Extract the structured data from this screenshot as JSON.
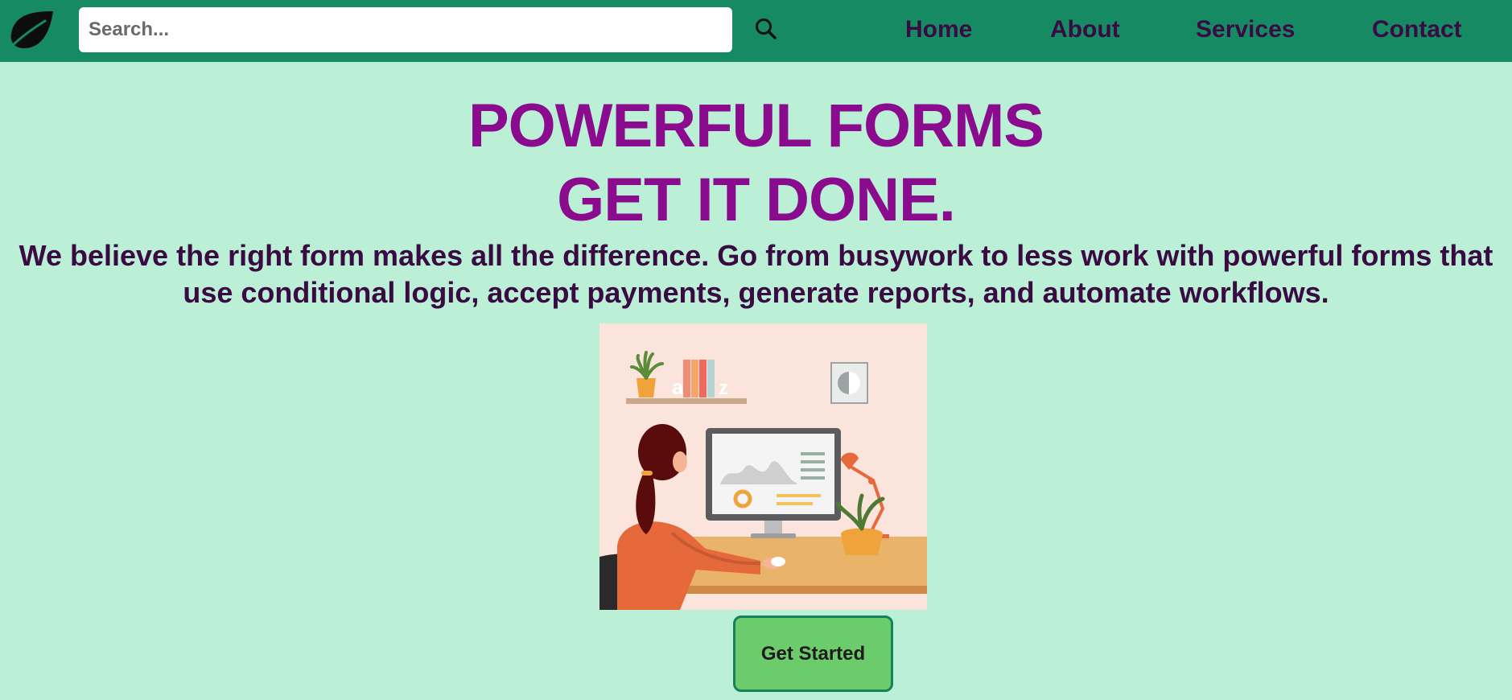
{
  "colors": {
    "navbar_bg": "#168a63",
    "page_bg": "#bbefd6",
    "headline": "#8b0b8e",
    "body_text": "#3a0a42",
    "button_bg": "#6ccb6a",
    "button_border": "#16815d"
  },
  "header": {
    "logo_icon": "leaf-icon",
    "search": {
      "placeholder": "Search...",
      "value": "",
      "icon": "search-icon"
    },
    "nav": {
      "home": "Home",
      "about": "About",
      "services": "Services",
      "contact": "Contact"
    }
  },
  "hero": {
    "headline_line1": "POWERFUL FORMS",
    "headline_line2": "GET IT DONE.",
    "description": "We believe the right form makes all the difference. Go from busywork to less work with powerful forms that use conditional logic, accept payments, generate reports, and automate workflows.",
    "illustration": "woman-working-at-desk-illustration",
    "cta_label": "Get Started"
  }
}
